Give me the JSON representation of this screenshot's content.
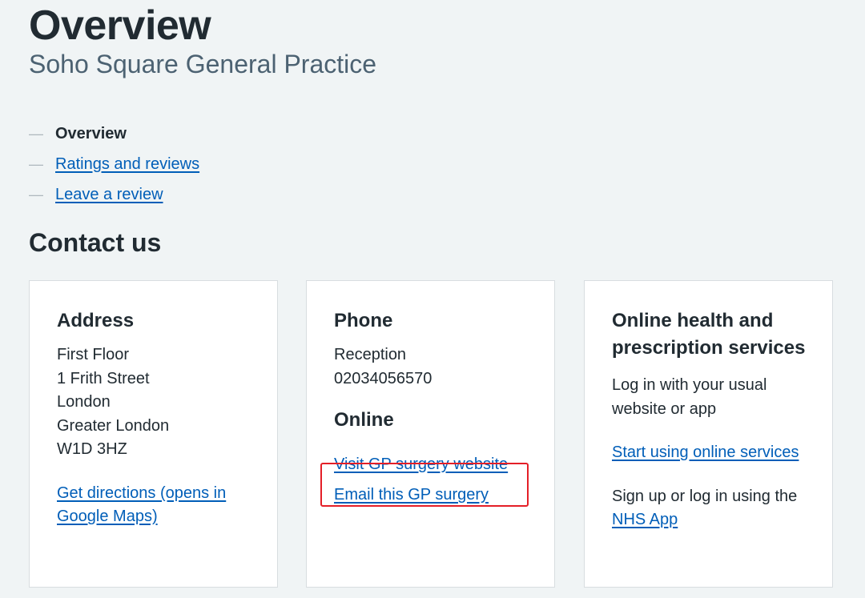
{
  "header": {
    "title": "Overview",
    "subtitle": "Soho Square General Practice"
  },
  "contents_nav": {
    "items": [
      {
        "label": "Overview",
        "current": true
      },
      {
        "label": "Ratings and reviews",
        "current": false
      },
      {
        "label": "Leave a review",
        "current": false
      }
    ]
  },
  "contact_section": {
    "title": "Contact us",
    "address_card": {
      "heading": "Address",
      "lines": [
        "First Floor",
        "1 Frith Street",
        "London",
        "Greater London",
        "W1D 3HZ"
      ],
      "directions_link": "Get directions (opens in Google Maps)"
    },
    "phone_card": {
      "heading": "Phone",
      "phone_label": "Reception",
      "phone_number": "02034056570",
      "online_heading": "Online",
      "website_link": "Visit GP surgery website",
      "email_link": "Email this GP surgery"
    },
    "online_services_card": {
      "heading": "Online health and prescription services",
      "intro": "Log in with your usual website or app",
      "start_link": "Start using online services",
      "app_text_prefix": "Sign up or log in using the",
      "app_link": "NHS App"
    }
  },
  "colors": {
    "background": "#f0f4f5",
    "link": "#005eb8",
    "text": "#212b32",
    "secondary_text": "#4c6272",
    "highlight": "#e41f27"
  }
}
